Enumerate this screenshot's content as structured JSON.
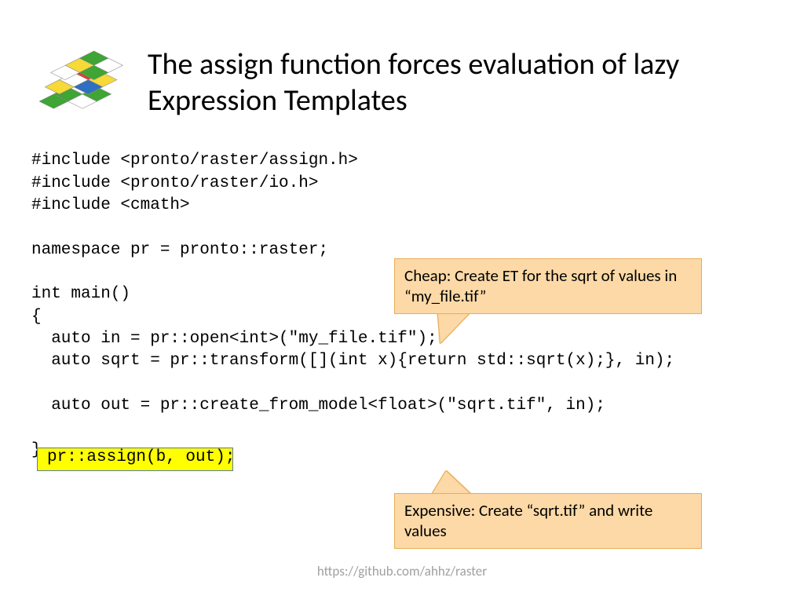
{
  "title": "The assign function forces evaluation of lazy Expression Templates",
  "code": "#include <pronto/raster/assign.h>\n#include <pronto/raster/io.h>\n#include <cmath>\n\nnamespace pr = pronto::raster;\n\nint main()\n{\n  auto in = pr::open<int>(\"my_file.tif\");\n  auto sqrt = pr::transform([](int x){return std::sqrt(x);}, in);\n\n  auto out = pr::create_from_model<float>(\"sqrt.tif\", in);\n\n}",
  "highlight_code": "pr::assign(b, out);",
  "callout_top": "Cheap: Create ET  for the sqrt of values in “my_file.tif”",
  "callout_bottom": "Expensive: Create “sqrt.tif” and write values",
  "footer": "https://github.com/ahhz/raster",
  "logo_colors": {
    "green": "#3fa535",
    "red": "#e33a2f",
    "blue": "#2f6fc1",
    "yellow": "#f7d938",
    "white": "#ffffff",
    "stroke": "#888888"
  }
}
